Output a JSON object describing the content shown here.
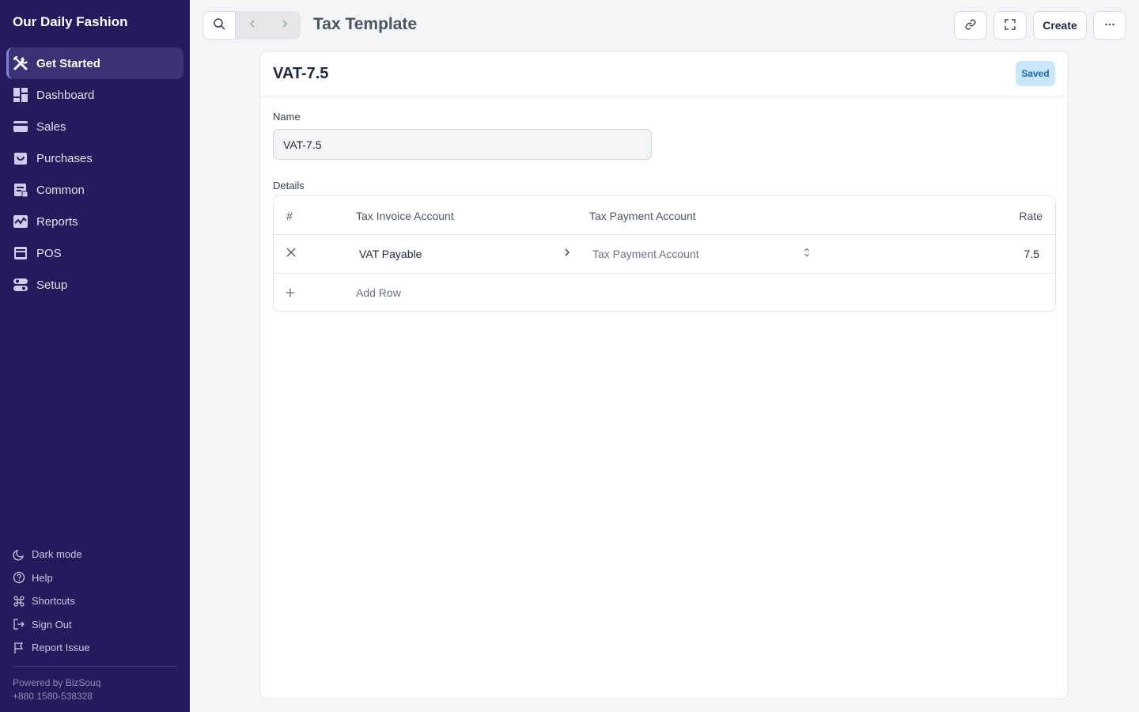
{
  "sidebar": {
    "brand": "Our Daily Fashion",
    "items": [
      {
        "label": "Get Started",
        "icon": "tools-icon"
      },
      {
        "label": "Dashboard",
        "icon": "dashboard-icon"
      },
      {
        "label": "Sales",
        "icon": "sales-icon"
      },
      {
        "label": "Purchases",
        "icon": "purchases-icon"
      },
      {
        "label": "Common",
        "icon": "common-icon"
      },
      {
        "label": "Reports",
        "icon": "reports-icon"
      },
      {
        "label": "POS",
        "icon": "pos-icon"
      },
      {
        "label": "Setup",
        "icon": "setup-icon"
      }
    ],
    "bottom_links": [
      {
        "label": "Dark mode",
        "icon": "moon-icon"
      },
      {
        "label": "Help",
        "icon": "help-icon"
      },
      {
        "label": "Shortcuts",
        "icon": "command-icon"
      },
      {
        "label": "Sign Out",
        "icon": "sign-out-icon"
      },
      {
        "label": "Report Issue",
        "icon": "flag-icon"
      }
    ],
    "powered_by": "Powered by BizSouq",
    "phone": "+880 1580-538328"
  },
  "topbar": {
    "title": "Tax Template",
    "create_label": "Create"
  },
  "document": {
    "title": "VAT-7.5",
    "status": "Saved",
    "name_label": "Name",
    "name_value": "VAT-7.5",
    "details_label": "Details"
  },
  "table": {
    "headers": {
      "index": "#",
      "invoice_account": "Tax Invoice Account",
      "payment_account": "Tax Payment Account",
      "rate": "Rate"
    },
    "rows": [
      {
        "invoice_account": "VAT Payable",
        "payment_account_placeholder": "Tax Payment Account",
        "rate": "7.5"
      }
    ],
    "add_row_label": "Add Row"
  },
  "colors": {
    "sidebar_bg": "#251b5c",
    "active_item_bg": "#3b3275",
    "saved_badge_bg": "#c9e6fb",
    "saved_badge_text": "#1e66b0"
  }
}
